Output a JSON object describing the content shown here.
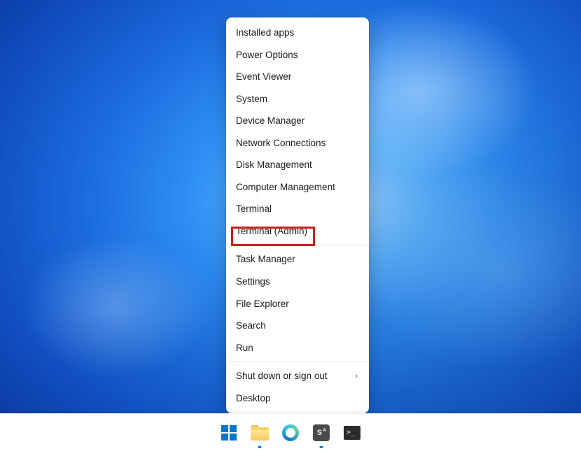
{
  "context_menu": {
    "groups": [
      [
        {
          "label": "Installed apps",
          "name": "menu-item-installed-apps"
        },
        {
          "label": "Power Options",
          "name": "menu-item-power-options"
        },
        {
          "label": "Event Viewer",
          "name": "menu-item-event-viewer"
        },
        {
          "label": "System",
          "name": "menu-item-system"
        },
        {
          "label": "Device Manager",
          "name": "menu-item-device-manager"
        },
        {
          "label": "Network Connections",
          "name": "menu-item-network-connections"
        },
        {
          "label": "Disk Management",
          "name": "menu-item-disk-management"
        },
        {
          "label": "Computer Management",
          "name": "menu-item-computer-management"
        },
        {
          "label": "Terminal",
          "name": "menu-item-terminal"
        },
        {
          "label": "Terminal (Admin)",
          "name": "menu-item-terminal-admin",
          "highlighted": true
        }
      ],
      [
        {
          "label": "Task Manager",
          "name": "menu-item-task-manager"
        },
        {
          "label": "Settings",
          "name": "menu-item-settings"
        },
        {
          "label": "File Explorer",
          "name": "menu-item-file-explorer"
        },
        {
          "label": "Search",
          "name": "menu-item-search"
        },
        {
          "label": "Run",
          "name": "menu-item-run"
        }
      ],
      [
        {
          "label": "Shut down or sign out",
          "name": "menu-item-shutdown-signout",
          "submenu": true
        },
        {
          "label": "Desktop",
          "name": "menu-item-desktop"
        }
      ]
    ]
  },
  "taskbar": {
    "items": [
      {
        "name": "start-button",
        "icon": "windows-logo-icon",
        "underline": false
      },
      {
        "name": "file-explorer-button",
        "icon": "file-explorer-icon",
        "underline": true
      },
      {
        "name": "edge-button",
        "icon": "edge-icon",
        "underline": false
      },
      {
        "name": "sublime-button",
        "icon": "app-s-icon",
        "underline": true,
        "glyph": "S",
        "sup": "A"
      },
      {
        "name": "terminal-button",
        "icon": "terminal-icon",
        "underline": false,
        "glyph": ">_"
      }
    ]
  },
  "annotation": {
    "highlight_color": "#d11a1a"
  }
}
